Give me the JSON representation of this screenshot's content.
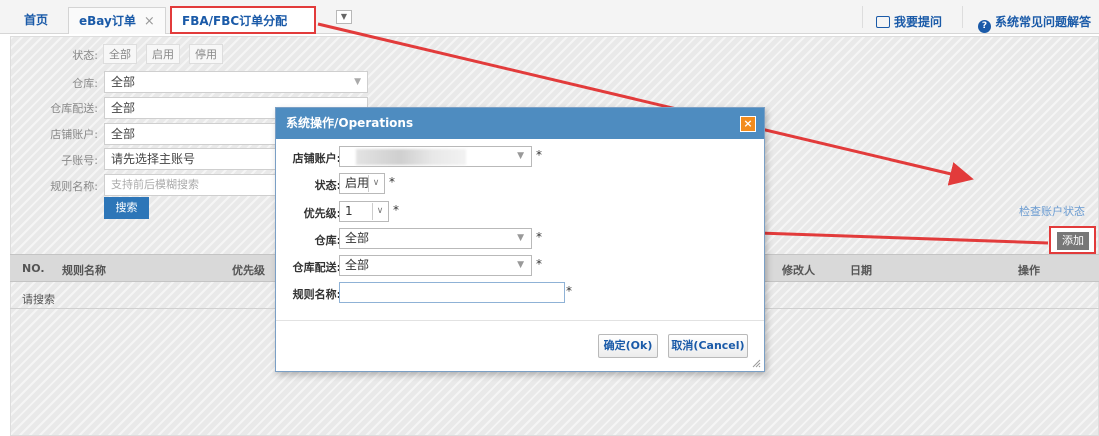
{
  "tabs": [
    {
      "label": "首页"
    },
    {
      "label": "eBay订单",
      "close": "×"
    },
    {
      "label": "FBA/FBC订单分配规...",
      "close": "×"
    }
  ],
  "tab_dropdown": "▼",
  "top_links": {
    "ask": "我要提问",
    "faq": "系统常见问题解答"
  },
  "filters": {
    "status_label": "状态:",
    "status_options": [
      "全部",
      "启用",
      "停用"
    ],
    "warehouse_label": "仓库:",
    "warehouse_value": "全部",
    "delivery_label": "仓库配送:",
    "delivery_value": "全部",
    "shop_label": "店铺账户:",
    "shop_value": "全部",
    "subaccount_label": "子账号:",
    "subaccount_value": "请先选择主账号",
    "rulename_label": "规则名称:",
    "rulename_placeholder": "支持前后模糊搜索",
    "search_button": "搜索"
  },
  "check_account_link": "检查账户状态",
  "add_button": "添加",
  "table": {
    "headers": [
      "NO.",
      "规则名称",
      "优先级",
      "修改人",
      "日期",
      "操作"
    ],
    "empty_text": "请搜索"
  },
  "dialog": {
    "title": "系统操作/Operations",
    "close": "×",
    "fields": {
      "shop_label": "店铺账户:",
      "status_label": "状态:",
      "status_value": "启用",
      "priority_label": "优先级:",
      "priority_value": "1",
      "warehouse_label": "仓库:",
      "warehouse_value": "全部",
      "delivery_label": "仓库配送:",
      "delivery_value": "全部",
      "rulename_label": "规则名称:",
      "rulename_value": ""
    },
    "required_mark": "*",
    "ok_button": "确定(Ok)",
    "cancel_button": "取消(Cancel)"
  },
  "colors": {
    "accent": "#4e8cc0",
    "highlight": "#e23b3b",
    "link": "#1a5aa8"
  }
}
